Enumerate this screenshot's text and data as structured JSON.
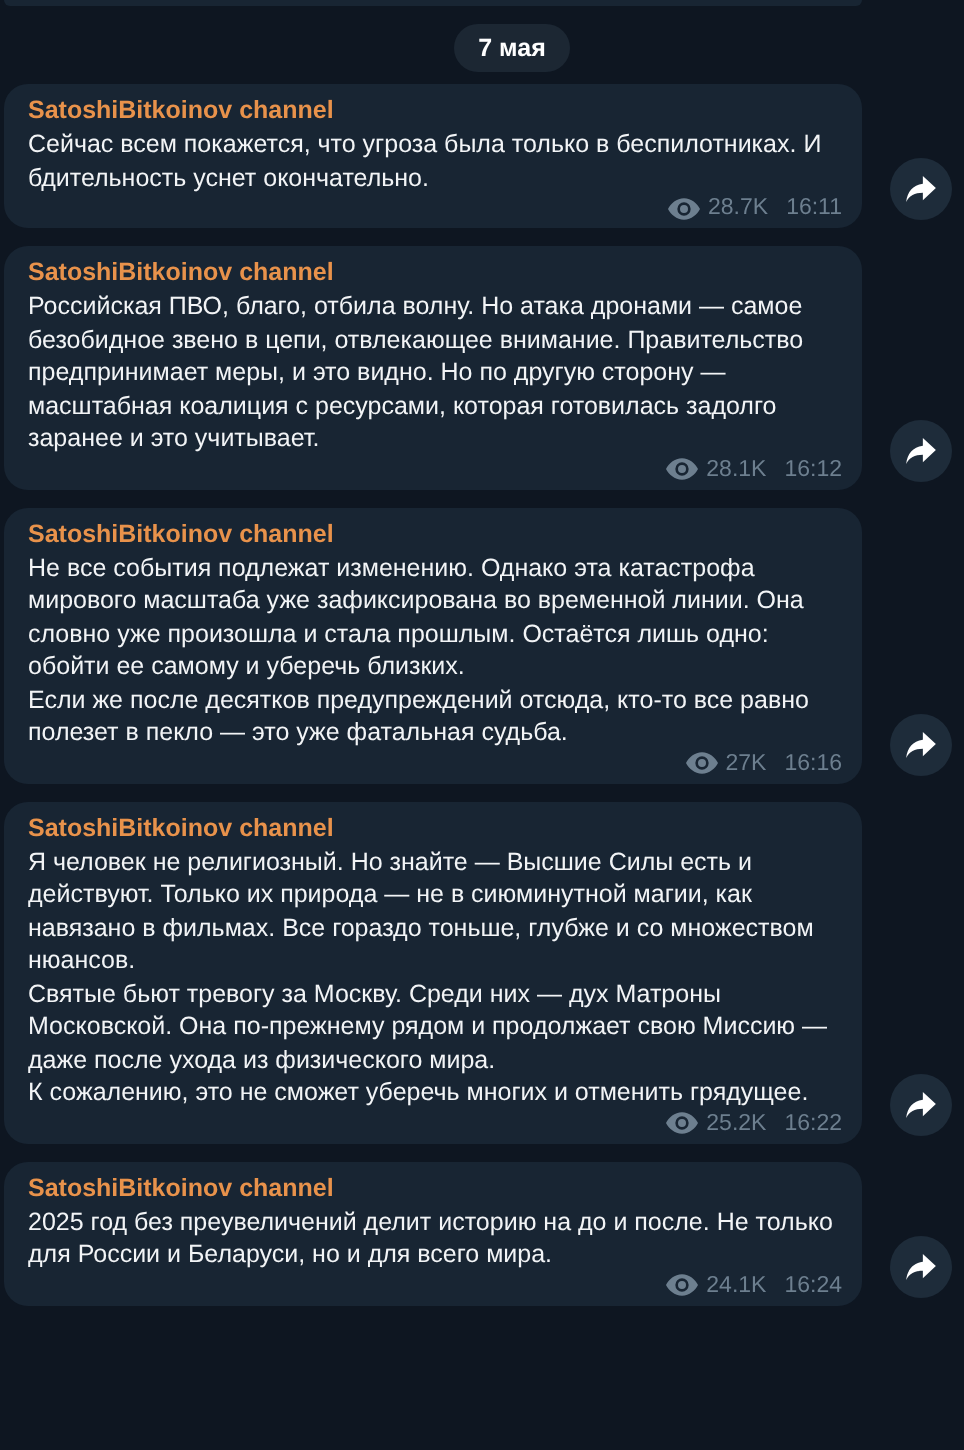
{
  "date_badge": "7 мая",
  "messages": [
    {
      "author": "SatoshiBitkoinov channel",
      "text": "Сейчас всем покажется, что угроза была только в беспилотниках. И бдительность уснет окончательно.",
      "views": "28.7K",
      "time": "16:11"
    },
    {
      "author": "SatoshiBitkoinov channel",
      "text": "Российская ПВО, благо, отбила волну. Но атака дронами — самое безобидное звено в цепи, отвлекающее внимание. Правительство предпринимает меры, и это видно. Но по другую сторону — масштабная коалиция с ресурсами, которая готовилась задолго заранее и это учитывает.",
      "views": "28.1K",
      "time": "16:12"
    },
    {
      "author": "SatoshiBitkoinov channel",
      "text": "Не все события подлежат изменению. Однако эта катастрофа мирового масштаба уже зафиксирована во временной линии. Она словно уже произошла и стала прошлым. Остаётся лишь одно: обойти ее самому и уберечь близких.\nЕсли же после десятков предупреждений отсюда, кто-то все равно полезет в пекло — это уже фатальная судьба.",
      "views": "27K",
      "time": "16:16"
    },
    {
      "author": "SatoshiBitkoinov channel",
      "text": "Я человек не религиозный. Но знайте — Высшие Силы есть и действуют. Только их природа — не в сиюминутной магии, как навязано в фильмах. Все гораздо тоньше, глубже и со множеством нюансов.\nСвятые бьют тревогу за Москву. Среди них — дух Матроны Московской. Она по-прежнему рядом и продолжает свою Миссию — даже после ухода из физического мира.\nК сожалению, это не сможет уберечь многих и отменить грядущее.",
      "views": "25.2K",
      "time": "16:22"
    },
    {
      "author": "SatoshiBitkoinov channel",
      "text": "2025 год без преувеличений делит историю на до и после. Не только для России и Беларуси, но и для всего мира.",
      "views": "24.1K",
      "time": "16:24"
    }
  ]
}
